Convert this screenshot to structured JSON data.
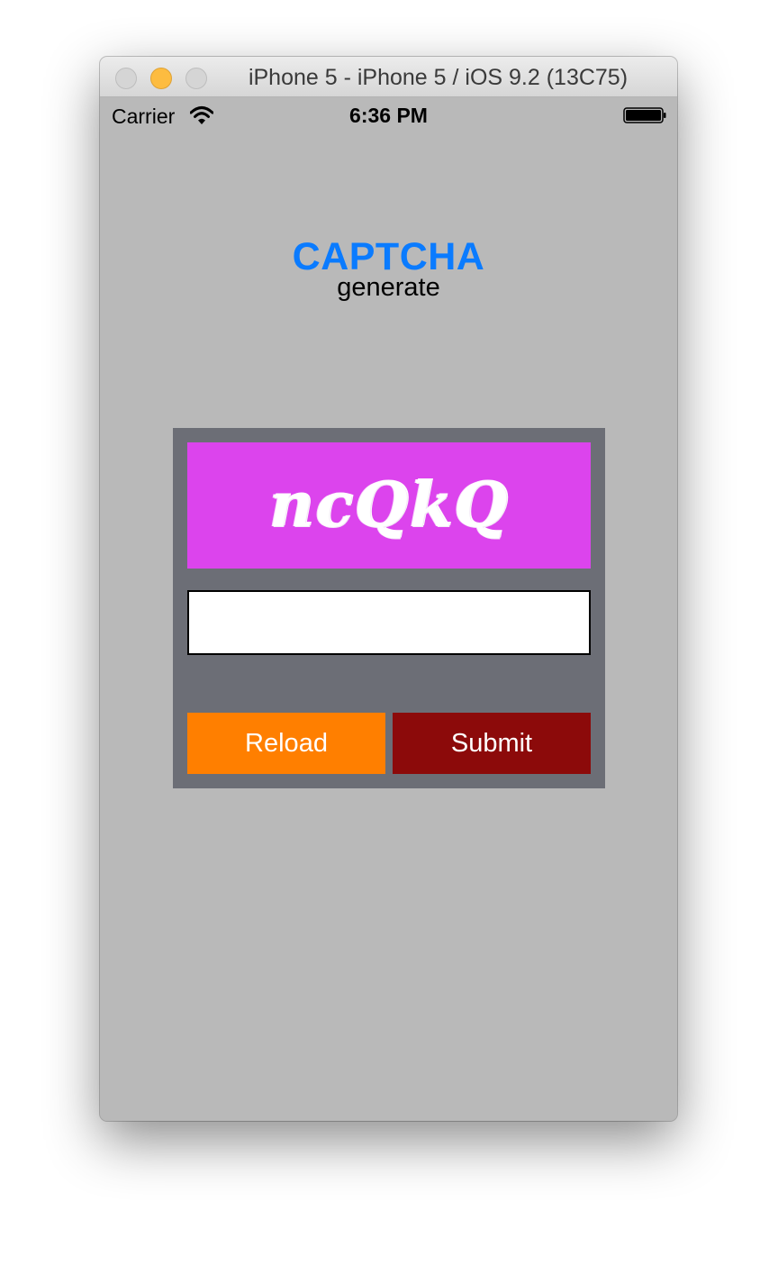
{
  "window": {
    "title": "iPhone 5 - iPhone 5 / iOS 9.2 (13C75)"
  },
  "statusbar": {
    "carrier": "Carrier",
    "time": "6:36 PM",
    "wifi_icon": "wifi-icon",
    "battery_icon": "battery-full-icon"
  },
  "header": {
    "title": "CAPTCHA",
    "subtitle": "generate"
  },
  "captcha": {
    "code": "ncQkQ",
    "input_value": "",
    "reload_label": "Reload",
    "submit_label": "Submit"
  },
  "colors": {
    "background": "#b9b9b9",
    "title": "#0a7bff",
    "panel": "#6c6e76",
    "captcha_bg": "#dc44ed",
    "reload_button": "#ff7f00",
    "submit_button": "#8c0a0a"
  }
}
